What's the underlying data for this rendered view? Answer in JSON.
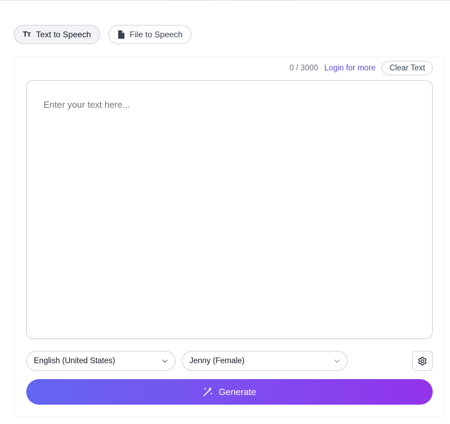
{
  "tabs": [
    {
      "label": "Text to Speech",
      "icon": "text-icon",
      "active": true
    },
    {
      "label": "File to Speech",
      "icon": "file-icon",
      "active": false
    }
  ],
  "editor": {
    "char_count": "0 / 3000",
    "login_link": "Login for more",
    "clear_label": "Clear Text",
    "placeholder": "Enter your text here..."
  },
  "controls": {
    "language": "English (United States)",
    "voice": "Jenny (Female)",
    "settings_icon": "gear-icon"
  },
  "generate": {
    "label": "Generate",
    "icon": "magic-wand-icon"
  },
  "colors": {
    "accent_start": "#6366f1",
    "accent_end": "#9333ea",
    "link": "#5b4fd6"
  }
}
